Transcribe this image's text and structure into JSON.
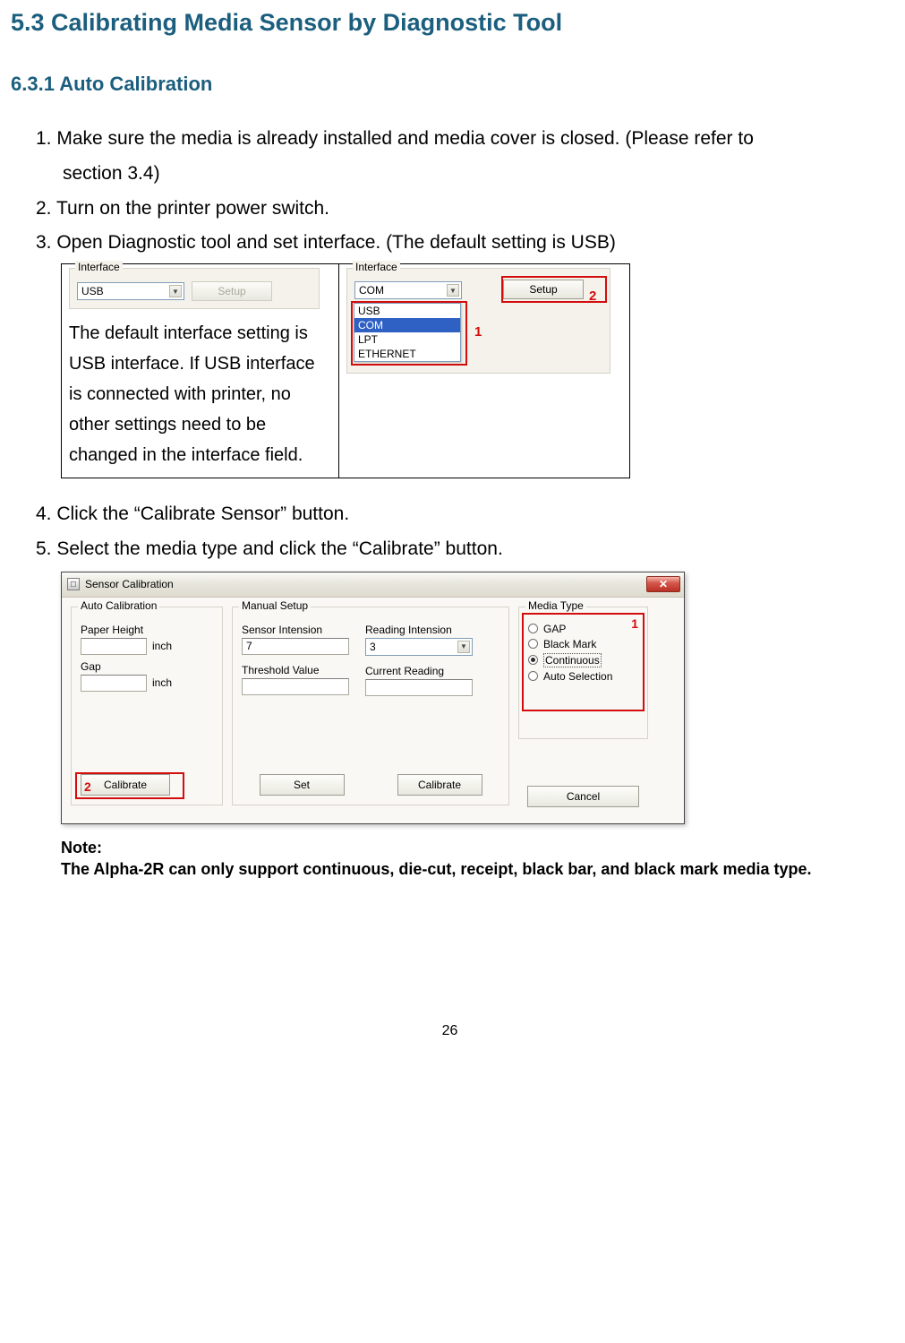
{
  "heading_main": "5.3   Calibrating Media Sensor by Diagnostic Tool",
  "heading_sub": "6.3.1 Auto Calibration",
  "steps": {
    "s1a": "1. Make sure the media is already installed and media cover is closed. (Please refer to",
    "s1b": "section 3.4)",
    "s2": "2. Turn on the printer power switch.",
    "s3": "3. Open Diagnostic tool and set interface. (The default setting is USB)",
    "s4": "4. Click the “Calibrate Sensor” button.",
    "s5": "5. Select the media type and click the “Calibrate” button."
  },
  "panel_left": {
    "group_label": "Interface",
    "select_value": "USB",
    "setup_btn": "Setup",
    "desc": "The default interface setting is USB interface. If USB interface is connected with printer, no other settings need to be changed in the interface field."
  },
  "panel_right": {
    "group_label": "Interface",
    "select_value": "COM",
    "setup_btn": "Setup",
    "opts": {
      "o1": "USB",
      "o2": "COM",
      "o3": "LPT",
      "o4": "ETHERNET"
    },
    "ann1": "1",
    "ann2": "2"
  },
  "dialog": {
    "title": "Sensor Calibration",
    "auto": {
      "group": "Auto Calibration",
      "ph_label": "Paper Height",
      "gap_label": "Gap",
      "unit": "inch",
      "calibrate_btn": "Calibrate"
    },
    "manual": {
      "group": "Manual Setup",
      "si_label": "Sensor Intension",
      "si_value": "7",
      "ri_label": "Reading Intension",
      "ri_value": "3",
      "tv_label": "Threshold Value",
      "cr_label": "Current Reading",
      "set_btn": "Set",
      "calibrate_btn": "Calibrate"
    },
    "media": {
      "group": "Media Type",
      "r1": "GAP",
      "r2": "Black Mark",
      "r3": "Continuous",
      "r4": "Auto Selection"
    },
    "cancel_btn": "Cancel",
    "ann1": "1",
    "ann2": "2"
  },
  "note": {
    "t1": "Note:",
    "t2": "The Alpha-2R can only support continuous, die-cut, receipt, black bar, and black mark media type."
  },
  "page_number": "26"
}
